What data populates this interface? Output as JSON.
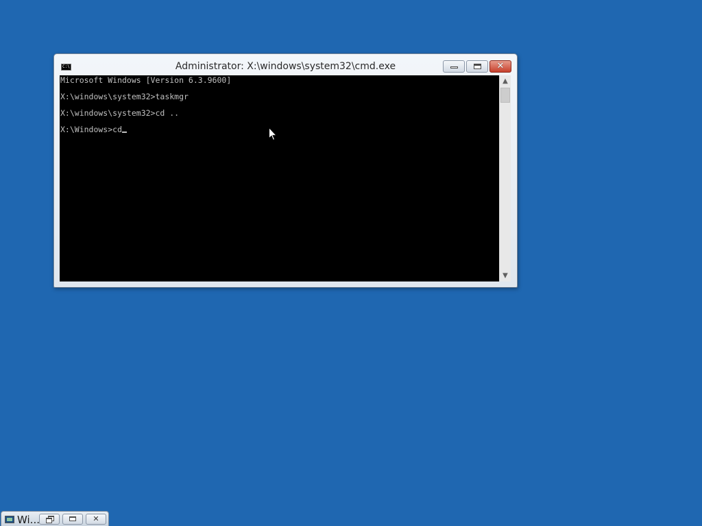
{
  "desktop": {
    "background_color": "#1f67b1"
  },
  "cmd_window": {
    "title": "Administrator: X:\\windows\\system32\\cmd.exe",
    "icon": "console-icon",
    "icon_text": "C:\\",
    "controls": {
      "minimize": "minimize-icon",
      "maximize": "maximize-icon",
      "close": "close-icon"
    },
    "console": {
      "lines": [
        "Microsoft Windows [Version 6.3.9600]",
        "X:\\windows\\system32>taskmgr",
        "X:\\windows\\system32>cd ..",
        "X:\\Windows>cd"
      ],
      "text_color": "#c0c0c0",
      "background_color": "#000000"
    },
    "scrollbar": {
      "up_arrow": "▲",
      "down_arrow": "▼"
    }
  },
  "minimized_window": {
    "title": "Wi...",
    "icon": "app-window-icon",
    "controls": {
      "restore": "restore-icon",
      "maximize": "maximize-icon",
      "close": "close-icon",
      "close_glyph": "✕"
    }
  },
  "pointer": {
    "icon": "mouse-pointer-icon"
  }
}
